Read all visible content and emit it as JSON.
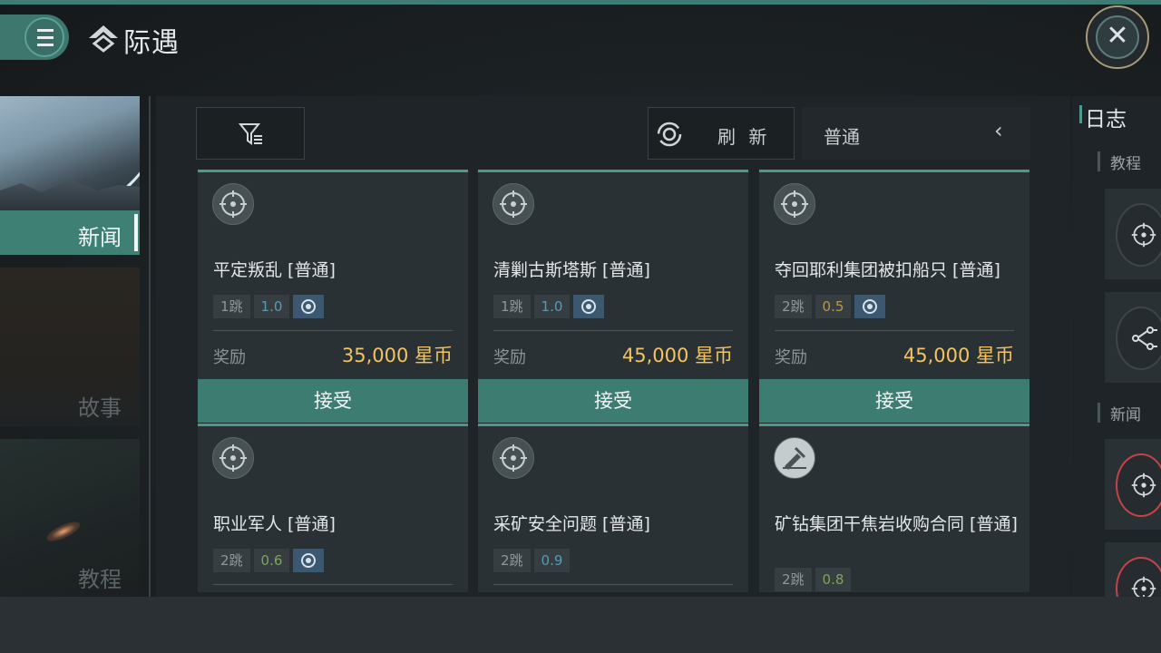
{
  "header": {
    "title": "际遇",
    "menu_icon": "hamburger-icon",
    "close_icon": "close-icon"
  },
  "nav": [
    {
      "label": "新闻",
      "active": true
    },
    {
      "label": "故事",
      "active": false
    },
    {
      "label": "教程",
      "active": false
    }
  ],
  "toolbar": {
    "filter_icon": "filter-icon",
    "refresh_label": "刷 新",
    "mode_value": "普通"
  },
  "missions": [
    {
      "title": "平定叛乱 [普通]",
      "jumps": "1跳",
      "security": "1.0",
      "security_color": "#5a9ab5",
      "has_badge": true,
      "reward_label": "奖励",
      "reward": "35,000 星币",
      "accept_label": "接受",
      "icon": "combat-target-icon"
    },
    {
      "title": "清剿古斯塔斯 [普通]",
      "jumps": "1跳",
      "security": "1.0",
      "security_color": "#5a9ab5",
      "has_badge": true,
      "reward_label": "奖励",
      "reward": "45,000 星币",
      "accept_label": "接受",
      "icon": "combat-target-icon"
    },
    {
      "title": "夺回耶利集团被扣船只 [普通]",
      "jumps": "2跳",
      "security": "0.5",
      "security_color": "#b49a55",
      "has_badge": true,
      "reward_label": "奖励",
      "reward": "45,000 星币",
      "accept_label": "接受",
      "icon": "combat-target-icon"
    },
    {
      "title": "职业军人 [普通]",
      "jumps": "2跳",
      "security": "0.6",
      "security_color": "#7fa55a",
      "has_badge": true,
      "icon": "combat-target-icon"
    },
    {
      "title": "采矿安全问题 [普通]",
      "jumps": "2跳",
      "security": "0.9",
      "security_color": "#5a9ab5",
      "has_badge": false,
      "icon": "combat-target-icon"
    },
    {
      "title": "矿钻集团干焦岩收购合同 [普通]",
      "jumps": "2跳",
      "security": "0.8",
      "security_color": "#7fa55a",
      "has_badge": false,
      "icon": "mining-icon"
    }
  ],
  "log": {
    "title": "日志",
    "sections": [
      {
        "label": "教程",
        "items": [
          "combat-target-icon",
          "share-node-icon"
        ]
      },
      {
        "label": "新闻",
        "items": [
          "combat-target-icon",
          "combat-target-icon"
        ]
      }
    ]
  }
}
